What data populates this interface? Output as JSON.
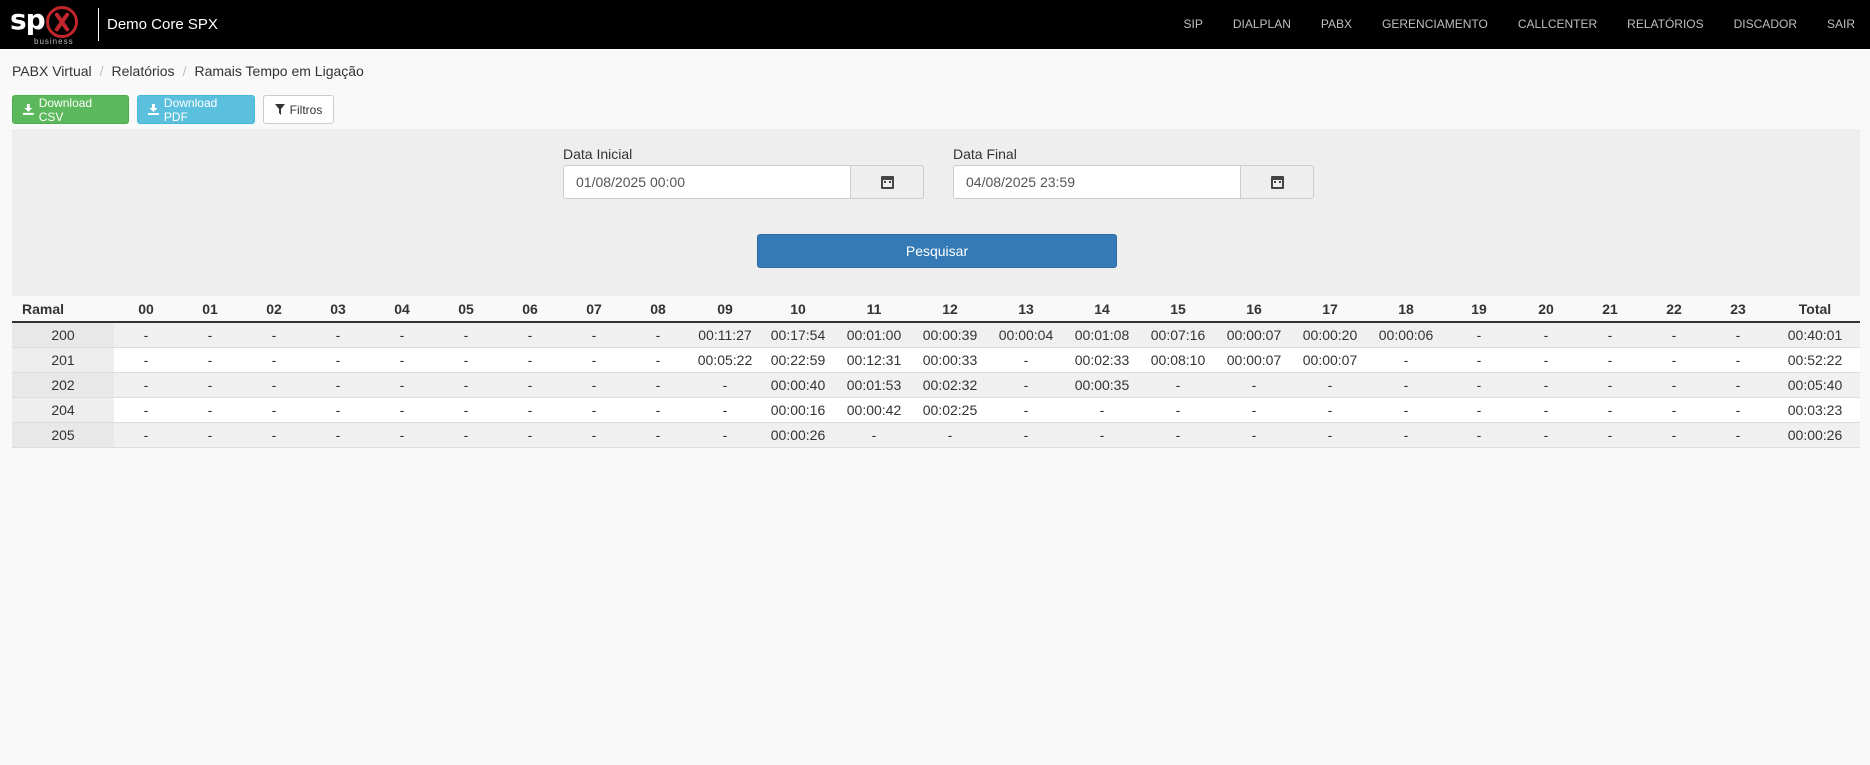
{
  "brand": {
    "logo_text": "sp",
    "logo_sub": "business",
    "title": "Demo Core SPX"
  },
  "nav": [
    "SIP",
    "DIALPLAN",
    "PABX",
    "GERENCIAMENTO",
    "CALLCENTER",
    "RELATÓRIOS",
    "DISCADOR",
    "SAIR"
  ],
  "breadcrumb": [
    "PABX Virtual",
    "Relatórios",
    "Ramais Tempo em Ligação"
  ],
  "toolbar": {
    "csv_label": "Download CSV",
    "pdf_label": "Download PDF",
    "filter_label": "Filtros"
  },
  "filters": {
    "start_label": "Data Inicial",
    "start_value": "01/08/2025 00:00",
    "end_label": "Data Final",
    "end_value": "04/08/2025 23:59",
    "search_label": "Pesquisar"
  },
  "table": {
    "headers": [
      "Ramal",
      "00",
      "01",
      "02",
      "03",
      "04",
      "05",
      "06",
      "07",
      "08",
      "09",
      "10",
      "11",
      "12",
      "13",
      "14",
      "15",
      "16",
      "17",
      "18",
      "19",
      "20",
      "21",
      "22",
      "23",
      "Total"
    ],
    "rows": [
      [
        "200",
        "-",
        "-",
        "-",
        "-",
        "-",
        "-",
        "-",
        "-",
        "-",
        "00:11:27",
        "00:17:54",
        "00:01:00",
        "00:00:39",
        "00:00:04",
        "00:01:08",
        "00:07:16",
        "00:00:07",
        "00:00:20",
        "00:00:06",
        "-",
        "-",
        "-",
        "-",
        "-",
        "00:40:01"
      ],
      [
        "201",
        "-",
        "-",
        "-",
        "-",
        "-",
        "-",
        "-",
        "-",
        "-",
        "00:05:22",
        "00:22:59",
        "00:12:31",
        "00:00:33",
        "-",
        "00:02:33",
        "00:08:10",
        "00:00:07",
        "00:00:07",
        "-",
        "-",
        "-",
        "-",
        "-",
        "-",
        "00:52:22"
      ],
      [
        "202",
        "-",
        "-",
        "-",
        "-",
        "-",
        "-",
        "-",
        "-",
        "-",
        "-",
        "00:00:40",
        "00:01:53",
        "00:02:32",
        "-",
        "00:00:35",
        "-",
        "-",
        "-",
        "-",
        "-",
        "-",
        "-",
        "-",
        "-",
        "00:05:40"
      ],
      [
        "204",
        "-",
        "-",
        "-",
        "-",
        "-",
        "-",
        "-",
        "-",
        "-",
        "-",
        "00:00:16",
        "00:00:42",
        "00:02:25",
        "-",
        "-",
        "-",
        "-",
        "-",
        "-",
        "-",
        "-",
        "-",
        "-",
        "-",
        "00:03:23"
      ],
      [
        "205",
        "-",
        "-",
        "-",
        "-",
        "-",
        "-",
        "-",
        "-",
        "-",
        "-",
        "00:00:26",
        "-",
        "-",
        "-",
        "-",
        "-",
        "-",
        "-",
        "-",
        "-",
        "-",
        "-",
        "-",
        "-",
        "00:00:26"
      ]
    ]
  }
}
